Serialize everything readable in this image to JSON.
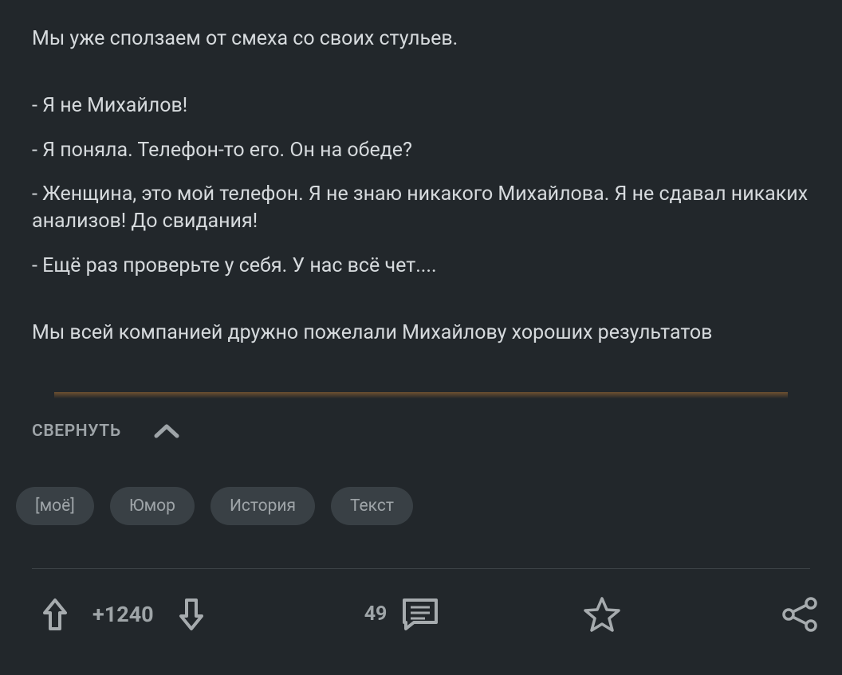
{
  "post": {
    "lines": {
      "intro": "Мы уже сползаем от смеха со своих стульев.",
      "d1": "- Я не Михайлов!",
      "d2": "- Я поняла. Телефон-то его. Он на обеде?",
      "d3": "- Женщина, это мой телефон. Я не знаю никакого Михайлова. Я не сдавал никаких анализов! До свидания!",
      "d4": "- Ещё раз проверьте у себя. У нас всё чет....",
      "outro": "Мы всей компанией дружно пожелали Михайлову хороших результатов"
    }
  },
  "collapse_label": "СВЕРНУТЬ",
  "tags": {
    "t0": "[моё]",
    "t1": "Юмор",
    "t2": "История",
    "t3": "Текст"
  },
  "footer": {
    "rating": "+1240",
    "comments": "49"
  },
  "colors": {
    "bg": "#22272b",
    "accent": "#f29839",
    "text": "#d6dadd",
    "muted": "#9ea4a8",
    "tag_bg": "#394045"
  }
}
